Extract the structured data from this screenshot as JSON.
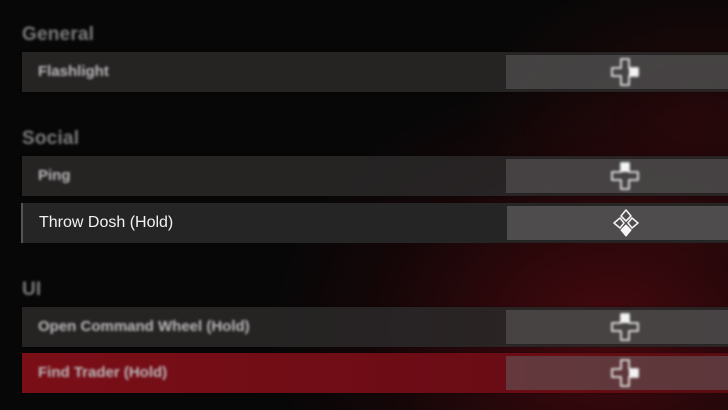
{
  "sections": [
    {
      "title": "General",
      "rows": [
        {
          "label": "Flashlight",
          "binding_icon": "dpad-right-icon"
        }
      ]
    },
    {
      "title": "Social",
      "rows": [
        {
          "label": "Ping",
          "binding_icon": "dpad-up-icon"
        },
        {
          "label": "Throw Dosh (Hold)",
          "binding_icon": "dpad-down-icon"
        }
      ]
    },
    {
      "title": "UI",
      "rows": [
        {
          "label": "Open Command Wheel (Hold)",
          "binding_icon": "dpad-up-icon"
        },
        {
          "label": "Find Trader (Hold)",
          "binding_icon": "dpad-right-icon"
        }
      ]
    }
  ],
  "colors": {
    "highlight_row": "#7a0e17",
    "focused_row": "#262525",
    "background": "#080707"
  }
}
